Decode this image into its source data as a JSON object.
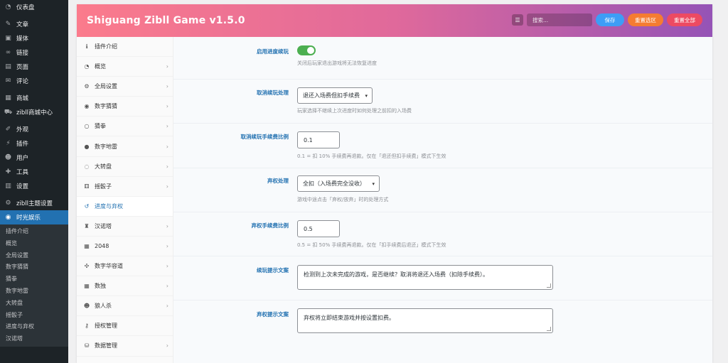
{
  "wp_menu": [
    {
      "label": "仪表盘",
      "icon": "dashboard-icon",
      "glyph": "◔"
    },
    {
      "sep": true
    },
    {
      "label": "文章",
      "icon": "pin-icon",
      "glyph": "✎"
    },
    {
      "label": "媒体",
      "icon": "media-icon",
      "glyph": "▣"
    },
    {
      "label": "链接",
      "icon": "link-icon",
      "glyph": "∞"
    },
    {
      "label": "页面",
      "icon": "page-icon",
      "glyph": "▤"
    },
    {
      "label": "评论",
      "icon": "comment-icon",
      "glyph": "✉"
    },
    {
      "sep": true
    },
    {
      "label": "商城",
      "icon": "shop-icon",
      "glyph": "▦"
    },
    {
      "label": "zibll商城中心",
      "icon": "cart-icon",
      "glyph": "⛟"
    },
    {
      "sep": true
    },
    {
      "label": "外观",
      "icon": "appearance-icon",
      "glyph": "✐"
    },
    {
      "label": "插件",
      "icon": "plugin-icon",
      "glyph": "⚡"
    },
    {
      "label": "用户",
      "icon": "user-icon",
      "glyph": "☻"
    },
    {
      "label": "工具",
      "icon": "tools-icon",
      "glyph": "✚"
    },
    {
      "label": "设置",
      "icon": "settings-icon",
      "glyph": "▥"
    },
    {
      "sep": true
    },
    {
      "label": "zibll主题设置",
      "icon": "gear-icon",
      "glyph": "⚙"
    },
    {
      "label": "时光娱乐",
      "icon": "gamepad-icon",
      "glyph": "◉",
      "active": true
    }
  ],
  "wp_submenu": [
    "插件介绍",
    "概览",
    "全局设置",
    "数字猜猜",
    "猜拳",
    "数字地雷",
    "大转盘",
    "摇骰子",
    "进度与弃权",
    "汉诺塔"
  ],
  "panel": {
    "title": "Shiguang Zibll Game v1.5.0",
    "search_placeholder": "搜索...",
    "save_label": "保存",
    "reset_section_label": "重置选区",
    "reset_all_label": "重置全部",
    "colors": {
      "save": "#3d9df6",
      "reset_section": "#f57c31",
      "reset_all": "#ed4a62",
      "active": "#2271b1"
    }
  },
  "nav": [
    {
      "label": "插件介绍",
      "icon": "info-icon",
      "glyph": "ℹ",
      "chevron": false
    },
    {
      "label": "概览",
      "icon": "dashboard-icon",
      "glyph": "◔",
      "chevron": true
    },
    {
      "label": "全局设置",
      "icon": "gear-icon",
      "glyph": "⚙",
      "chevron": true
    },
    {
      "label": "数字猜猜",
      "icon": "gamepad-icon",
      "glyph": "◉",
      "chevron": true
    },
    {
      "label": "猜拳",
      "icon": "circle-icon",
      "glyph": "○",
      "chevron": true
    },
    {
      "label": "数字地雷",
      "icon": "bomb-icon",
      "glyph": "●",
      "chevron": true
    },
    {
      "label": "大转盘",
      "icon": "wheel-icon",
      "glyph": "◌",
      "chevron": true
    },
    {
      "label": "摇骰子",
      "icon": "dice-icon",
      "glyph": "⚅",
      "chevron": true
    },
    {
      "label": "进度与弃权",
      "icon": "history-icon",
      "glyph": "↺",
      "chevron": false,
      "active": true
    },
    {
      "label": "汉诺塔",
      "icon": "tower-icon",
      "glyph": "♜",
      "chevron": true
    },
    {
      "label": "2048",
      "icon": "grid-icon",
      "glyph": "▦",
      "chevron": true
    },
    {
      "label": "数字华容道",
      "icon": "puzzle-icon",
      "glyph": "✣",
      "chevron": true
    },
    {
      "label": "数独",
      "icon": "grid-icon",
      "glyph": "▦",
      "chevron": true
    },
    {
      "label": "狼人杀",
      "icon": "users-icon",
      "glyph": "☻",
      "chevron": true
    },
    {
      "label": "授权管理",
      "icon": "key-icon",
      "glyph": "⚷",
      "chevron": false
    },
    {
      "label": "数据管理",
      "icon": "database-icon",
      "glyph": "⛁",
      "chevron": true
    }
  ],
  "fields": {
    "resume_enable": {
      "label": "启用进度续玩",
      "value": "on",
      "desc": "关闭后玩家退出游戏将无法恢复进度"
    },
    "cancel_resume": {
      "label": "取消续玩处理",
      "value": "退还入场费但扣手续费",
      "desc": "玩家选择不继续上次进度时如何处理之前扣的入场费"
    },
    "cancel_fee_ratio": {
      "label": "取消续玩手续费比例",
      "value": "0.1",
      "desc": "0.1 = 扣 10% 手续费再退款。仅在「退还但扣手续费」模式下生效"
    },
    "forfeit": {
      "label": "弃权处理",
      "value": "全扣（入场费完全没收）",
      "desc": "游戏中途点击「弃权/放弃」时的处理方式"
    },
    "forfeit_fee_ratio": {
      "label": "弃权手续费比例",
      "value": "0.5",
      "desc": "0.5 = 扣 50% 手续费再退款。仅在「扣手续费后退还」模式下生效"
    },
    "resume_prompt": {
      "label": "续玩提示文案",
      "value": "检测到上次未完成的游戏，是否继续？取消将退还入场费（扣除手续费）。"
    },
    "forfeit_prompt": {
      "label": "弃权提示文案",
      "value": "弃权将立即结束游戏并按设置扣费。"
    }
  }
}
